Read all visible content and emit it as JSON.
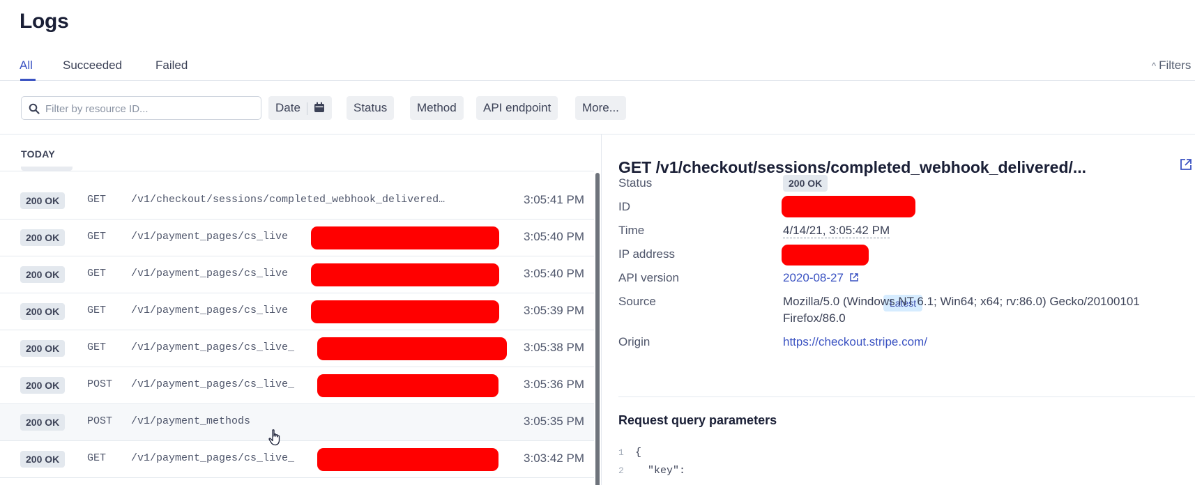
{
  "page": {
    "title": "Logs"
  },
  "tabs": [
    {
      "label": "All",
      "active": true
    },
    {
      "label": "Succeeded",
      "active": false
    },
    {
      "label": "Failed",
      "active": false
    }
  ],
  "filters_toggle": {
    "label": "Filters",
    "icon": "chevron-up-icon"
  },
  "search": {
    "placeholder": "Filter by resource ID...",
    "value": "",
    "icon": "search-icon"
  },
  "filter_chips": {
    "date": "Date",
    "status": "Status",
    "method": "Method",
    "api_endpoint": "API endpoint",
    "more": "More..."
  },
  "list": {
    "section_label": "TODAY",
    "rows": [
      {
        "status": "200 OK",
        "method": "GET",
        "path": "/v1/checkout/sessions/completed_webhook_delivered…",
        "time": "3:05:41 PM",
        "redacted": false
      },
      {
        "status": "200 OK",
        "method": "GET",
        "path": "/v1/payment_pages/cs_live",
        "time": "3:05:40 PM",
        "redacted": true
      },
      {
        "status": "200 OK",
        "method": "GET",
        "path": "/v1/payment_pages/cs_live",
        "time": "3:05:40 PM",
        "redacted": true
      },
      {
        "status": "200 OK",
        "method": "GET",
        "path": "/v1/payment_pages/cs_live",
        "time": "3:05:39 PM",
        "redacted": true
      },
      {
        "status": "200 OK",
        "method": "GET",
        "path": "/v1/payment_pages/cs_live_",
        "time": "3:05:38 PM",
        "redacted": true
      },
      {
        "status": "200 OK",
        "method": "POST",
        "path": "/v1/payment_pages/cs_live_",
        "time": "3:05:36 PM",
        "redacted": true
      },
      {
        "status": "200 OK",
        "method": "POST",
        "path": "/v1/payment_methods",
        "time": "3:05:35 PM",
        "redacted": false,
        "hovered": true
      },
      {
        "status": "200 OK",
        "method": "GET",
        "path": "/v1/payment_pages/cs_live_",
        "time": "3:03:42 PM",
        "redacted": true
      }
    ]
  },
  "detail": {
    "title": "GET /v1/checkout/sessions/completed_webhook_delivered/...",
    "fields": {
      "status_label": "Status",
      "status_value": "200 OK",
      "id_label": "ID",
      "time_label": "Time",
      "time_value": "4/14/21, 3:05:42 PM",
      "ip_label": "IP address",
      "api_version_label": "API version",
      "api_version_value": "2020-08-27",
      "api_version_tag": "Latest",
      "source_label": "Source",
      "source_value_line1": "Mozilla/5.0 (Windows NT 6.1; Win64; x64; rv:86.0) Gecko/20100101",
      "source_value_line2": "Firefox/86.0",
      "origin_label": "Origin",
      "origin_value": "https://checkout.stripe.com/"
    },
    "request_query_heading": "Request query parameters",
    "code_lines": [
      {
        "num": "1",
        "text": "{"
      },
      {
        "num": "2",
        "text": "  \"key\":"
      }
    ]
  },
  "colors": {
    "accent": "#3a52c2",
    "badge_bg": "#e3e8ee",
    "latest_bg": "#d6ecff",
    "redaction": "#ff0000"
  }
}
